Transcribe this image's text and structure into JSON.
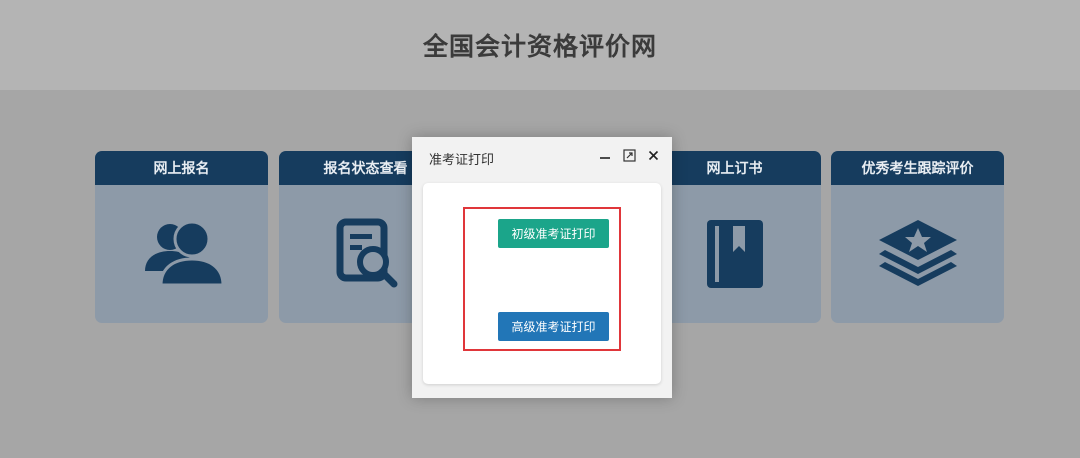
{
  "header": {
    "title": "全国会计资格评价网"
  },
  "cards": [
    {
      "label": "网上报名",
      "icon": "users-icon"
    },
    {
      "label": "报名状态查看",
      "icon": "document-search-icon"
    },
    {
      "label": "网上订书",
      "icon": "book-bookmark-icon"
    },
    {
      "label": "优秀考生跟踪评价",
      "icon": "layers-star-icon"
    }
  ],
  "modal": {
    "title": "准考证打印",
    "buttons": {
      "primary": "初级准考证打印",
      "advanced": "高级准考证打印"
    },
    "controls": [
      "minimize-icon",
      "maximize-icon",
      "close-icon"
    ]
  },
  "colors": {
    "card_header": "#163c5e",
    "card_body": "#8d9aa8",
    "icon": "#163c5e",
    "green_button": "#1ba58a",
    "blue_button": "#2276b7",
    "highlight_border": "#e0363a"
  }
}
